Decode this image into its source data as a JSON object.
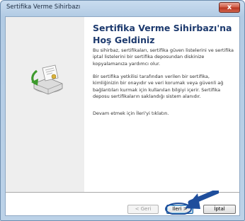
{
  "window": {
    "title": "Sertifika Verme Sihirbazı",
    "close_glyph": "x"
  },
  "wizard": {
    "heading": "Sertifika Verme Sihirbazı'na Hoş Geldiniz",
    "paragraph1": "Bu sihirbaz, sertifikaları, sertifika güven listelerini ve sertifika iptal listelerini bir sertifika deposundan diskinize kopyalamanıza yardımcı olur.",
    "paragraph2": "Bir sertifika yetkilisi tarafından verilen bir sertifika, kimliğinizin bir onayıdır ve veri korumak veya güvenli ağ bağlantıları kurmak için kullanılan bilgiyi içerir. Sertifika deposu sertifikaların saklandığı sistem alanıdır.",
    "paragraph3": "Devam etmek için İleri'yi tıklatın."
  },
  "buttons": {
    "back": "< Geri",
    "next": "İleri >",
    "cancel": "İptal"
  },
  "icons": {
    "wizard": "certificate-export-icon",
    "callout": "arrow-icon"
  },
  "colors": {
    "heading": "#1d3a6e",
    "callout_arrow": "#1f4e9c",
    "left_pane": "#eeeeee"
  }
}
